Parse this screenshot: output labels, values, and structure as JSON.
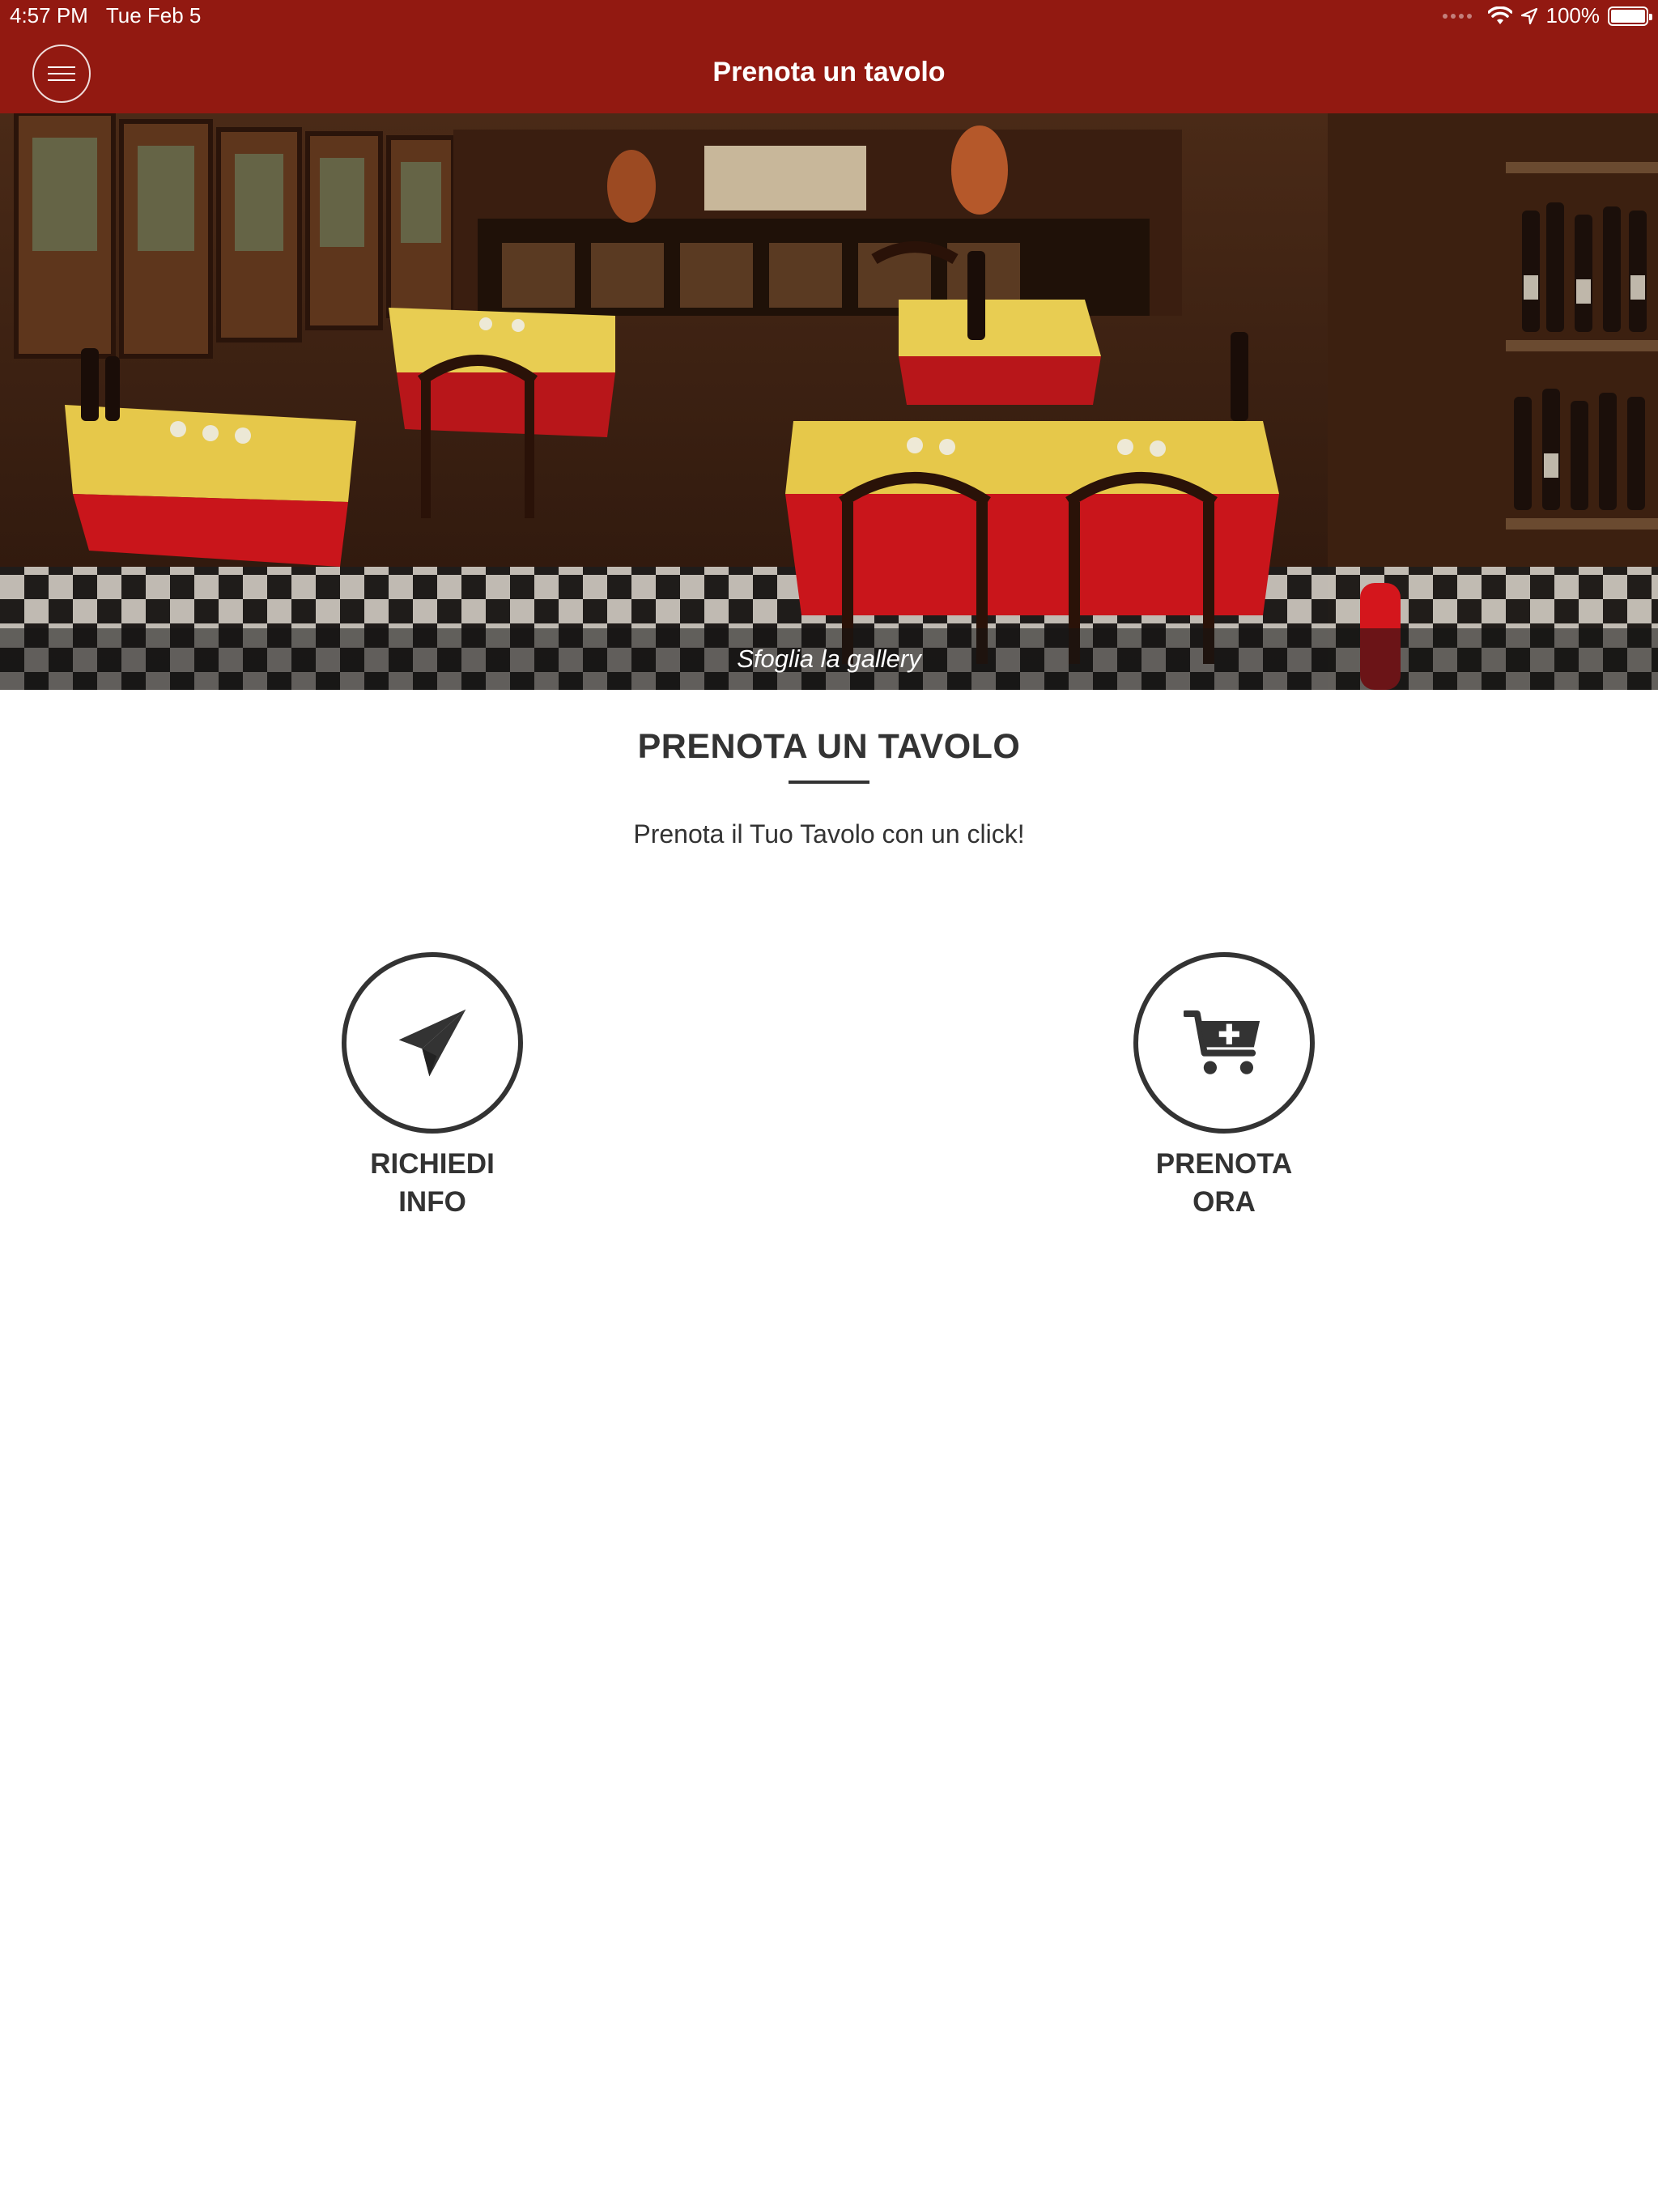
{
  "status_bar": {
    "time": "4:57 PM",
    "date": "Tue Feb 5",
    "battery": "100%",
    "battery_level": 1.0
  },
  "nav": {
    "title": "Prenota un tavolo",
    "menu_icon": "hamburger-menu-icon"
  },
  "hero": {
    "caption": "Sfoglia la gallery"
  },
  "section": {
    "title": "PRENOTA UN TAVOLO",
    "subtitle": "Prenota il Tuo Tavolo con un click!"
  },
  "actions": [
    {
      "line1": "RICHIEDI",
      "line2": "INFO",
      "icon": "paper-plane-icon"
    },
    {
      "line1": "PRENOTA",
      "line2": "ORA",
      "icon": "cart-plus-icon"
    }
  ],
  "colors": {
    "brand_red": "#921911",
    "text_dark": "#333333",
    "background": "#ffffff"
  }
}
